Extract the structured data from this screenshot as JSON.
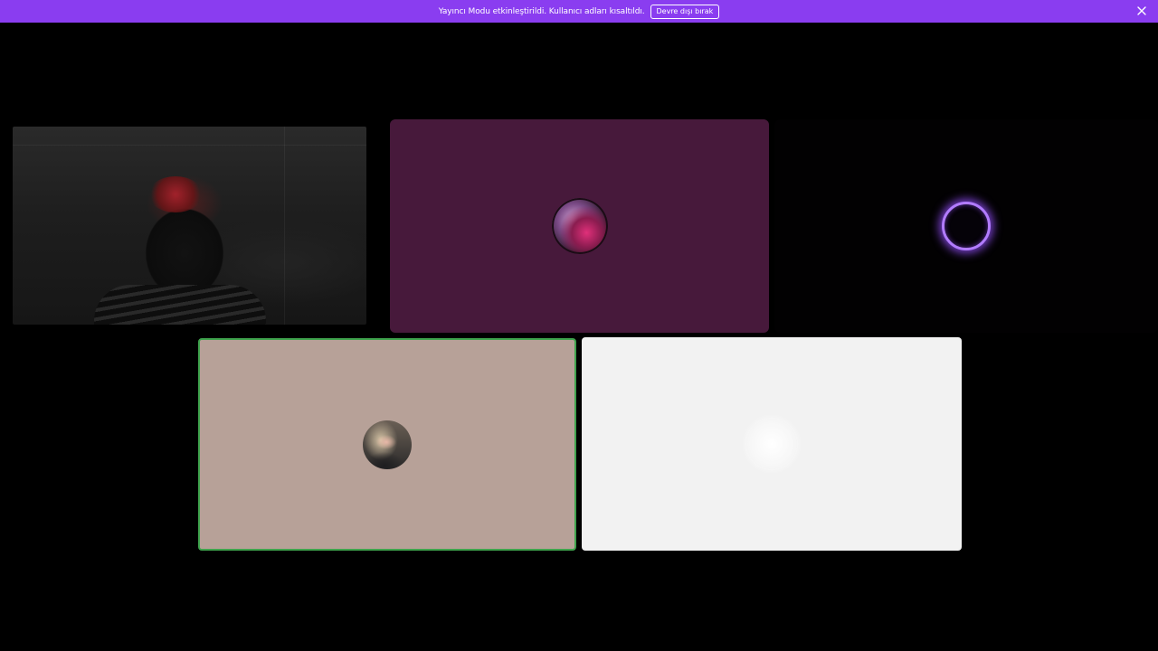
{
  "banner": {
    "message": "Yayıncı Modu etkinleştirildi. Kullanıcı adları kısaltıldı.",
    "disable_button_label": "Devre dışı bırak",
    "close_icon": "close-icon",
    "color": "#8a3df0"
  },
  "call": {
    "participants": [
      {
        "id": "participant-1",
        "kind": "camera-video"
      },
      {
        "id": "participant-2",
        "kind": "avatar",
        "tile_color": "#47193b"
      },
      {
        "id": "participant-3",
        "kind": "avatar",
        "tile_color": "#020102",
        "ring_color": "#b27cff"
      },
      {
        "id": "participant-4",
        "kind": "avatar",
        "tile_color": "#b7a198",
        "speaking": true,
        "speaking_color": "#3fa34d"
      },
      {
        "id": "participant-5",
        "kind": "avatar",
        "tile_color": "#f2f2f2"
      }
    ]
  }
}
